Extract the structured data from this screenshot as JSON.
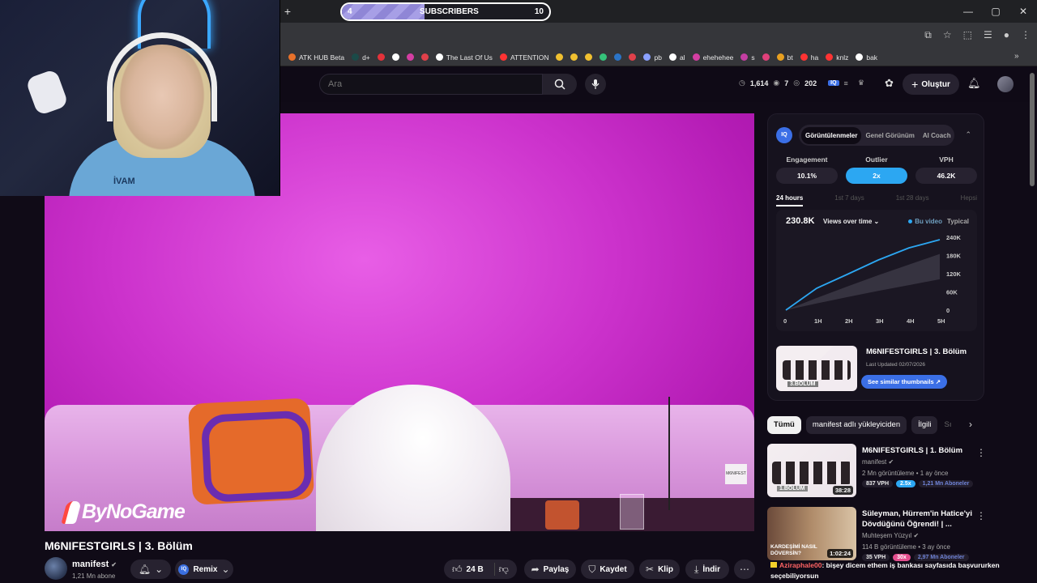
{
  "browser": {
    "new_tab": "+",
    "sub_goal": {
      "left": "4",
      "label": "SUBSCRIBERS",
      "right": "10",
      "progress": 0.4
    },
    "window_controls": [
      "—",
      "▢",
      "✕"
    ],
    "bookmarks": [
      {
        "label": "ATK HUB Beta",
        "color": "#e8712a"
      },
      {
        "label": "d+",
        "color": "#1b4a48"
      },
      {
        "label": "",
        "color": "#e4323a"
      },
      {
        "label": "",
        "color": "#ffffff"
      },
      {
        "label": "",
        "color": "#d43ea2"
      },
      {
        "label": "",
        "color": "#e0404a"
      },
      {
        "label": "The Last Of Us",
        "color": "#ffffff"
      },
      {
        "label": "ATTENTION",
        "color": "#ff3333"
      },
      {
        "label": "",
        "color": "#f0c030"
      },
      {
        "label": "",
        "color": "#f0c030"
      },
      {
        "label": "",
        "color": "#f0c030"
      },
      {
        "label": "",
        "color": "#35c27a"
      },
      {
        "label": "",
        "color": "#2b74c7"
      },
      {
        "label": "",
        "color": "#e0404a"
      },
      {
        "label": "pb",
        "color": "#8aa0ff"
      },
      {
        "label": "al",
        "color": "#ffffff"
      },
      {
        "label": "ehehehee",
        "color": "#d43ea2"
      },
      {
        "label": "s",
        "color": "#c43ea2"
      },
      {
        "label": "",
        "color": "#e0407a"
      },
      {
        "label": "bt",
        "color": "#e8a020"
      },
      {
        "label": "ha",
        "color": "#ff3333"
      },
      {
        "label": "knlz",
        "color": "#ff3333"
      },
      {
        "label": "bak",
        "color": "#ffffff"
      }
    ],
    "bookmarks_more": "»"
  },
  "youtube": {
    "search_placeholder": "Ara",
    "stats": {
      "a": "1,614",
      "b": "7",
      "c": "202"
    },
    "create_label": "Oluştur",
    "video": {
      "title": "M6NIFESTGIRLS | 3. Bölüm",
      "logo_text": "ByNoGame",
      "watermark": "M6NIFEST"
    },
    "channel": {
      "name": "manifest",
      "subs": "1,21 Mn abone"
    },
    "actions": {
      "remix": "Remix",
      "likes": "24 B",
      "share": "Paylaş",
      "save": "Kaydet",
      "clip": "Klip",
      "download": "İndir"
    }
  },
  "iq_panel": {
    "badge": "IQ",
    "tabs": [
      "Görüntülenmeler",
      "Genel Görünüm",
      "AI Coach"
    ],
    "metrics": [
      {
        "label": "Engagement",
        "value": "10.1%"
      },
      {
        "label": "Outlier",
        "value": "2x"
      },
      {
        "label": "VPH",
        "value": "46.2K"
      }
    ],
    "ranges": [
      "24 hours",
      "1st 7 days",
      "1st 28 days",
      "Hepsi"
    ],
    "chart_total": "230.8K",
    "chart_select": "Views over time",
    "legend": [
      "Bu video",
      "Typical"
    ],
    "thumb": {
      "title": "M6NIFESTGIRLS | 3. Bölüm",
      "updated": "Last Updated 02/07/2026",
      "button": "See similar thumbnails",
      "tag": "3.BÖLÜM"
    }
  },
  "chart_data": {
    "type": "line",
    "x": [
      "0",
      "1H",
      "2H",
      "3H",
      "4H",
      "5H"
    ],
    "series": [
      {
        "name": "Bu video",
        "values": [
          0,
          72000,
          118000,
          165000,
          205000,
          232000
        ]
      },
      {
        "name": "Typical",
        "values": [
          0,
          40000,
          78000,
          115000,
          150000,
          185000
        ]
      }
    ],
    "y_ticks": [
      "240K",
      "180K",
      "120K",
      "60K",
      "0"
    ],
    "ylim": [
      0,
      240000
    ],
    "xlabel": "",
    "ylabel": "",
    "title": "230.8K",
    "colors": {
      "main": "#2ca7f2",
      "typical": "#4a4654"
    }
  },
  "filters": [
    "Tümü",
    "manifest adlı yükleyiciden",
    "İlgili",
    "Sı"
  ],
  "recommendations": [
    {
      "title": "M6NIFESTGIRLS | 1. Bölüm",
      "channel": "manifest",
      "meta": "2 Mn görüntüleme • 1 ay önce",
      "duration": "38:28",
      "vph": "837 VPH",
      "outlier": "2.5x",
      "subs": "1,21 Mn Aboneler",
      "thumb_tag": "1.BÖLÜM"
    },
    {
      "title": "Süleyman, Hürrem'in Hatice'yi Dövdüğünü Öğrendi! | ...",
      "channel": "Muhteşem Yüzyıl",
      "meta": "114 B görüntüleme • 3 ay önce",
      "duration": "1:02:24",
      "vph": "35 VPH",
      "outlier": "30x",
      "subs": "2,97 Mn Aboneler",
      "thumb_tag": "KARDEŞİMİ NASIL DÖVERSİN?"
    }
  ],
  "chat": {
    "name": "Aziraphale00",
    "message": ": bişey dicem ethem iş bankası sayfasıda başvururken seçebiliyorsun"
  },
  "webcam": {
    "shirt_text": "İVAM"
  }
}
